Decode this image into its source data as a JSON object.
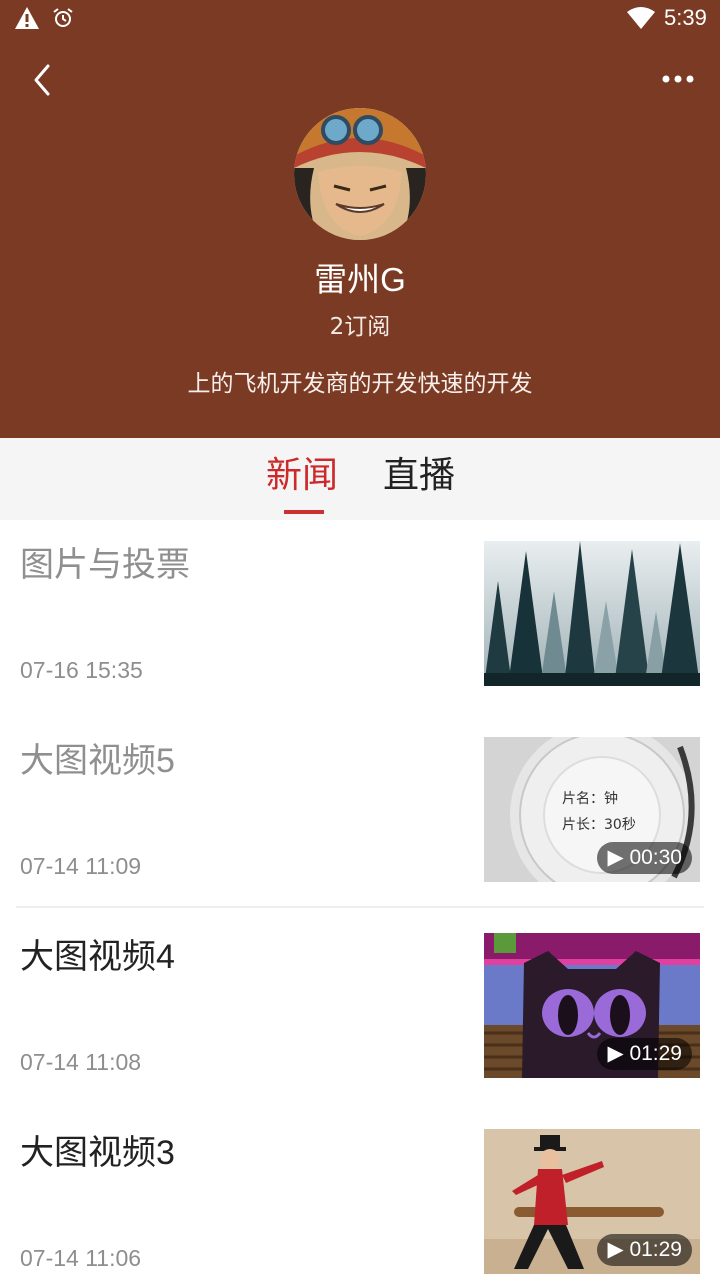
{
  "status_bar": {
    "time": "5:39",
    "icons": [
      "warning-icon",
      "alarm-icon",
      "wifi-icon"
    ]
  },
  "header": {
    "back_icon": "chevron-left-icon",
    "more_icon": "more-horizontal-icon",
    "channel_name": "雷州G",
    "subscriber_count": "2订阅",
    "description": "上的飞机开发商的开发快速的开发",
    "background_color": "#7b3a23"
  },
  "tabs": [
    {
      "label": "新闻",
      "active": true
    },
    {
      "label": "直播",
      "active": false
    }
  ],
  "accent_color": "#cc2a2a",
  "articles": [
    {
      "title": "图片与投票",
      "time": "07-16 15:35",
      "read": true,
      "duration": null,
      "thumb_caption_lines": []
    },
    {
      "title": "大图视频5",
      "time": "07-14 11:09",
      "read": true,
      "duration": "00:30",
      "thumb_caption_lines": [
        "片名：钟",
        "片长：30秒"
      ]
    },
    {
      "title": "大图视频4",
      "time": "07-14 11:08",
      "read": false,
      "duration": "01:29",
      "thumb_caption_lines": []
    },
    {
      "title": "大图视频3",
      "time": "07-14 11:06",
      "read": false,
      "duration": "01:29",
      "thumb_caption_lines": []
    }
  ]
}
